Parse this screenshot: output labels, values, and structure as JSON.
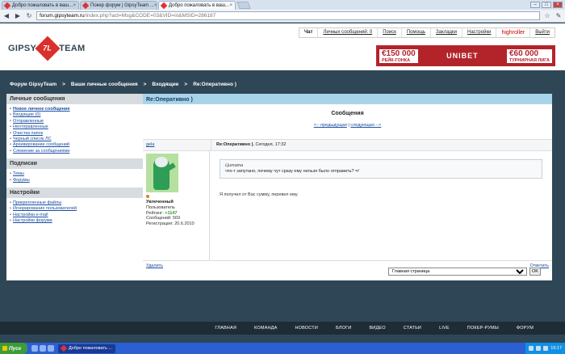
{
  "browser": {
    "tabs": [
      {
        "title": "Добро пожаловать в ваш...",
        "active": false
      },
      {
        "title": "Покер форум | GipsyTeam ...",
        "active": false
      },
      {
        "title": "Добро пожаловать в ваш...",
        "active": true
      }
    ],
    "url_host": "forum.gipsyteam.ru",
    "url_path": "/index.php?act=Msg&CODE=03&VID=in&MSID=286187"
  },
  "header": {
    "logo_left": "GIPSY",
    "logo_mark": "7L",
    "logo_right": "TEAM",
    "toplinks": [
      "Чат",
      "Личных сообщений: 0",
      "Поиск",
      "Помощь",
      "Закладки",
      "Настройки",
      "highroller",
      "Выйти"
    ],
    "banner": {
      "left_amount": "€150 000",
      "left_caption": "РЕЙК-ГОНКА",
      "brand": "UNIBET",
      "right_amount": "€60 000",
      "right_caption": "ТУРНИРНАЯ ЛИГА"
    }
  },
  "breadcrumb": [
    "Форум GipsyTeam",
    ">",
    "Ваши личные сообщения",
    ">",
    "Входящие",
    ">",
    "Re:Оперативно )"
  ],
  "sidebar": {
    "sections": [
      {
        "title": "Личные сообщения",
        "items": [
          "Новое личное сообщение",
          "Входящие (0)",
          "Отправленные",
          "Неотправленные",
          "Очистка папок",
          "Черный список ЛС",
          "Архивирование сообщений",
          "Слежение за сообщениями"
        ]
      },
      {
        "title": "Подписки",
        "items": [
          "Темы",
          "Форумы"
        ]
      },
      {
        "title": "Настройки",
        "items": [
          "Прикрепленные файлы",
          "Игнорирование пользователей",
          "Настройки e-mail",
          "Настройки форума"
        ]
      }
    ]
  },
  "content": {
    "header": "Re:Оперативно )",
    "title": "Сообщения",
    "prev": "<-- предыдущая",
    "separator": "|",
    "next": "следующая -->",
    "message": {
      "author": "gela",
      "subject": "Re:Оперативно )",
      "date": ", Сегодня, 17:32",
      "user_status": "Увлеченный",
      "user_group": "Пользователь",
      "rating_label": "Рейтинг:",
      "rating_value": "+1147",
      "posts": "Сообщений: 569",
      "registered": "Регистрация: 20.6.2010",
      "quote_title": "Цитата",
      "quote_text": "что-т запутано, почему чут сразу ему нельзя было отправить? =/",
      "body": "Я получил от Вас сумму, перевел ему.",
      "delete": "Удалить",
      "reply": "Ответить"
    }
  },
  "jump": {
    "selected": "Главная страница",
    "button": "OK"
  },
  "footer": [
    "ГЛАВНАЯ",
    "КОМАНДА",
    "НОВОСТИ",
    "БЛОГИ",
    "ВИДЕО",
    "СТАТЬИ",
    "LIVE",
    "ПОКЕР-РУМЫ",
    "ФОРУМ"
  ],
  "taskbar": {
    "start": "Пуск",
    "window": "Добро пожаловать ...",
    "clock": "19:17"
  }
}
